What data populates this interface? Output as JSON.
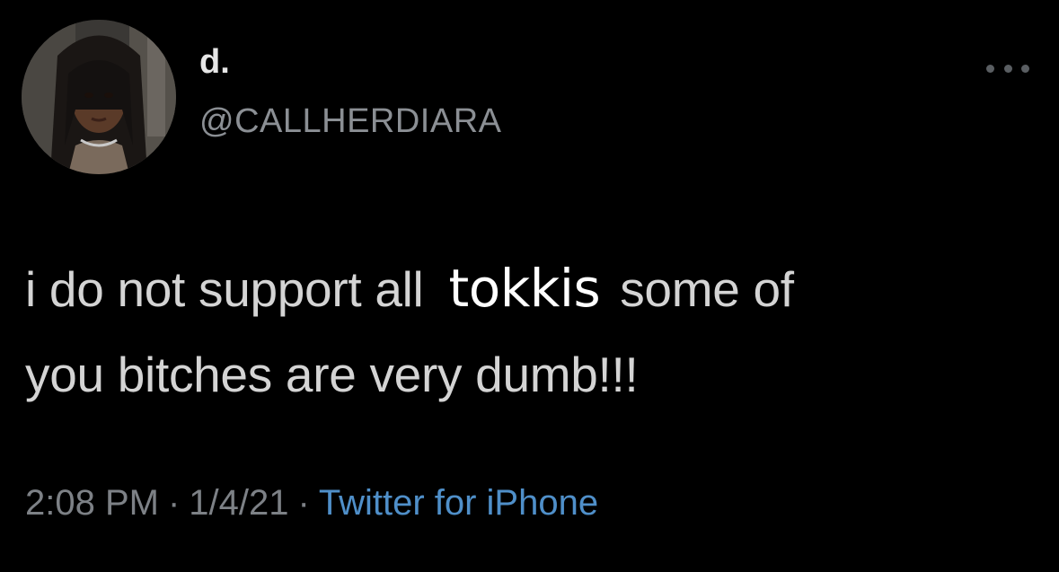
{
  "tweet": {
    "author": {
      "display_name": "d.",
      "handle": "@CALLHERDIARA",
      "avatar_icon": "profile-photo"
    },
    "more_icon": "ellipsis-icon",
    "text": {
      "line1_before": "i do not support all",
      "overlay_word": "tokkis",
      "line1_after": "some of",
      "line2": "you bitches are very dumb!!!"
    },
    "meta": {
      "time": "2:08 PM",
      "separator": "·",
      "date": "1/4/21",
      "source": "Twitter for iPhone"
    }
  },
  "colors": {
    "background": "#000000",
    "text": "#d4d4d4",
    "secondary": "#8b8f94",
    "link": "#4f8fc9",
    "overlay_text": "#ffffff"
  }
}
